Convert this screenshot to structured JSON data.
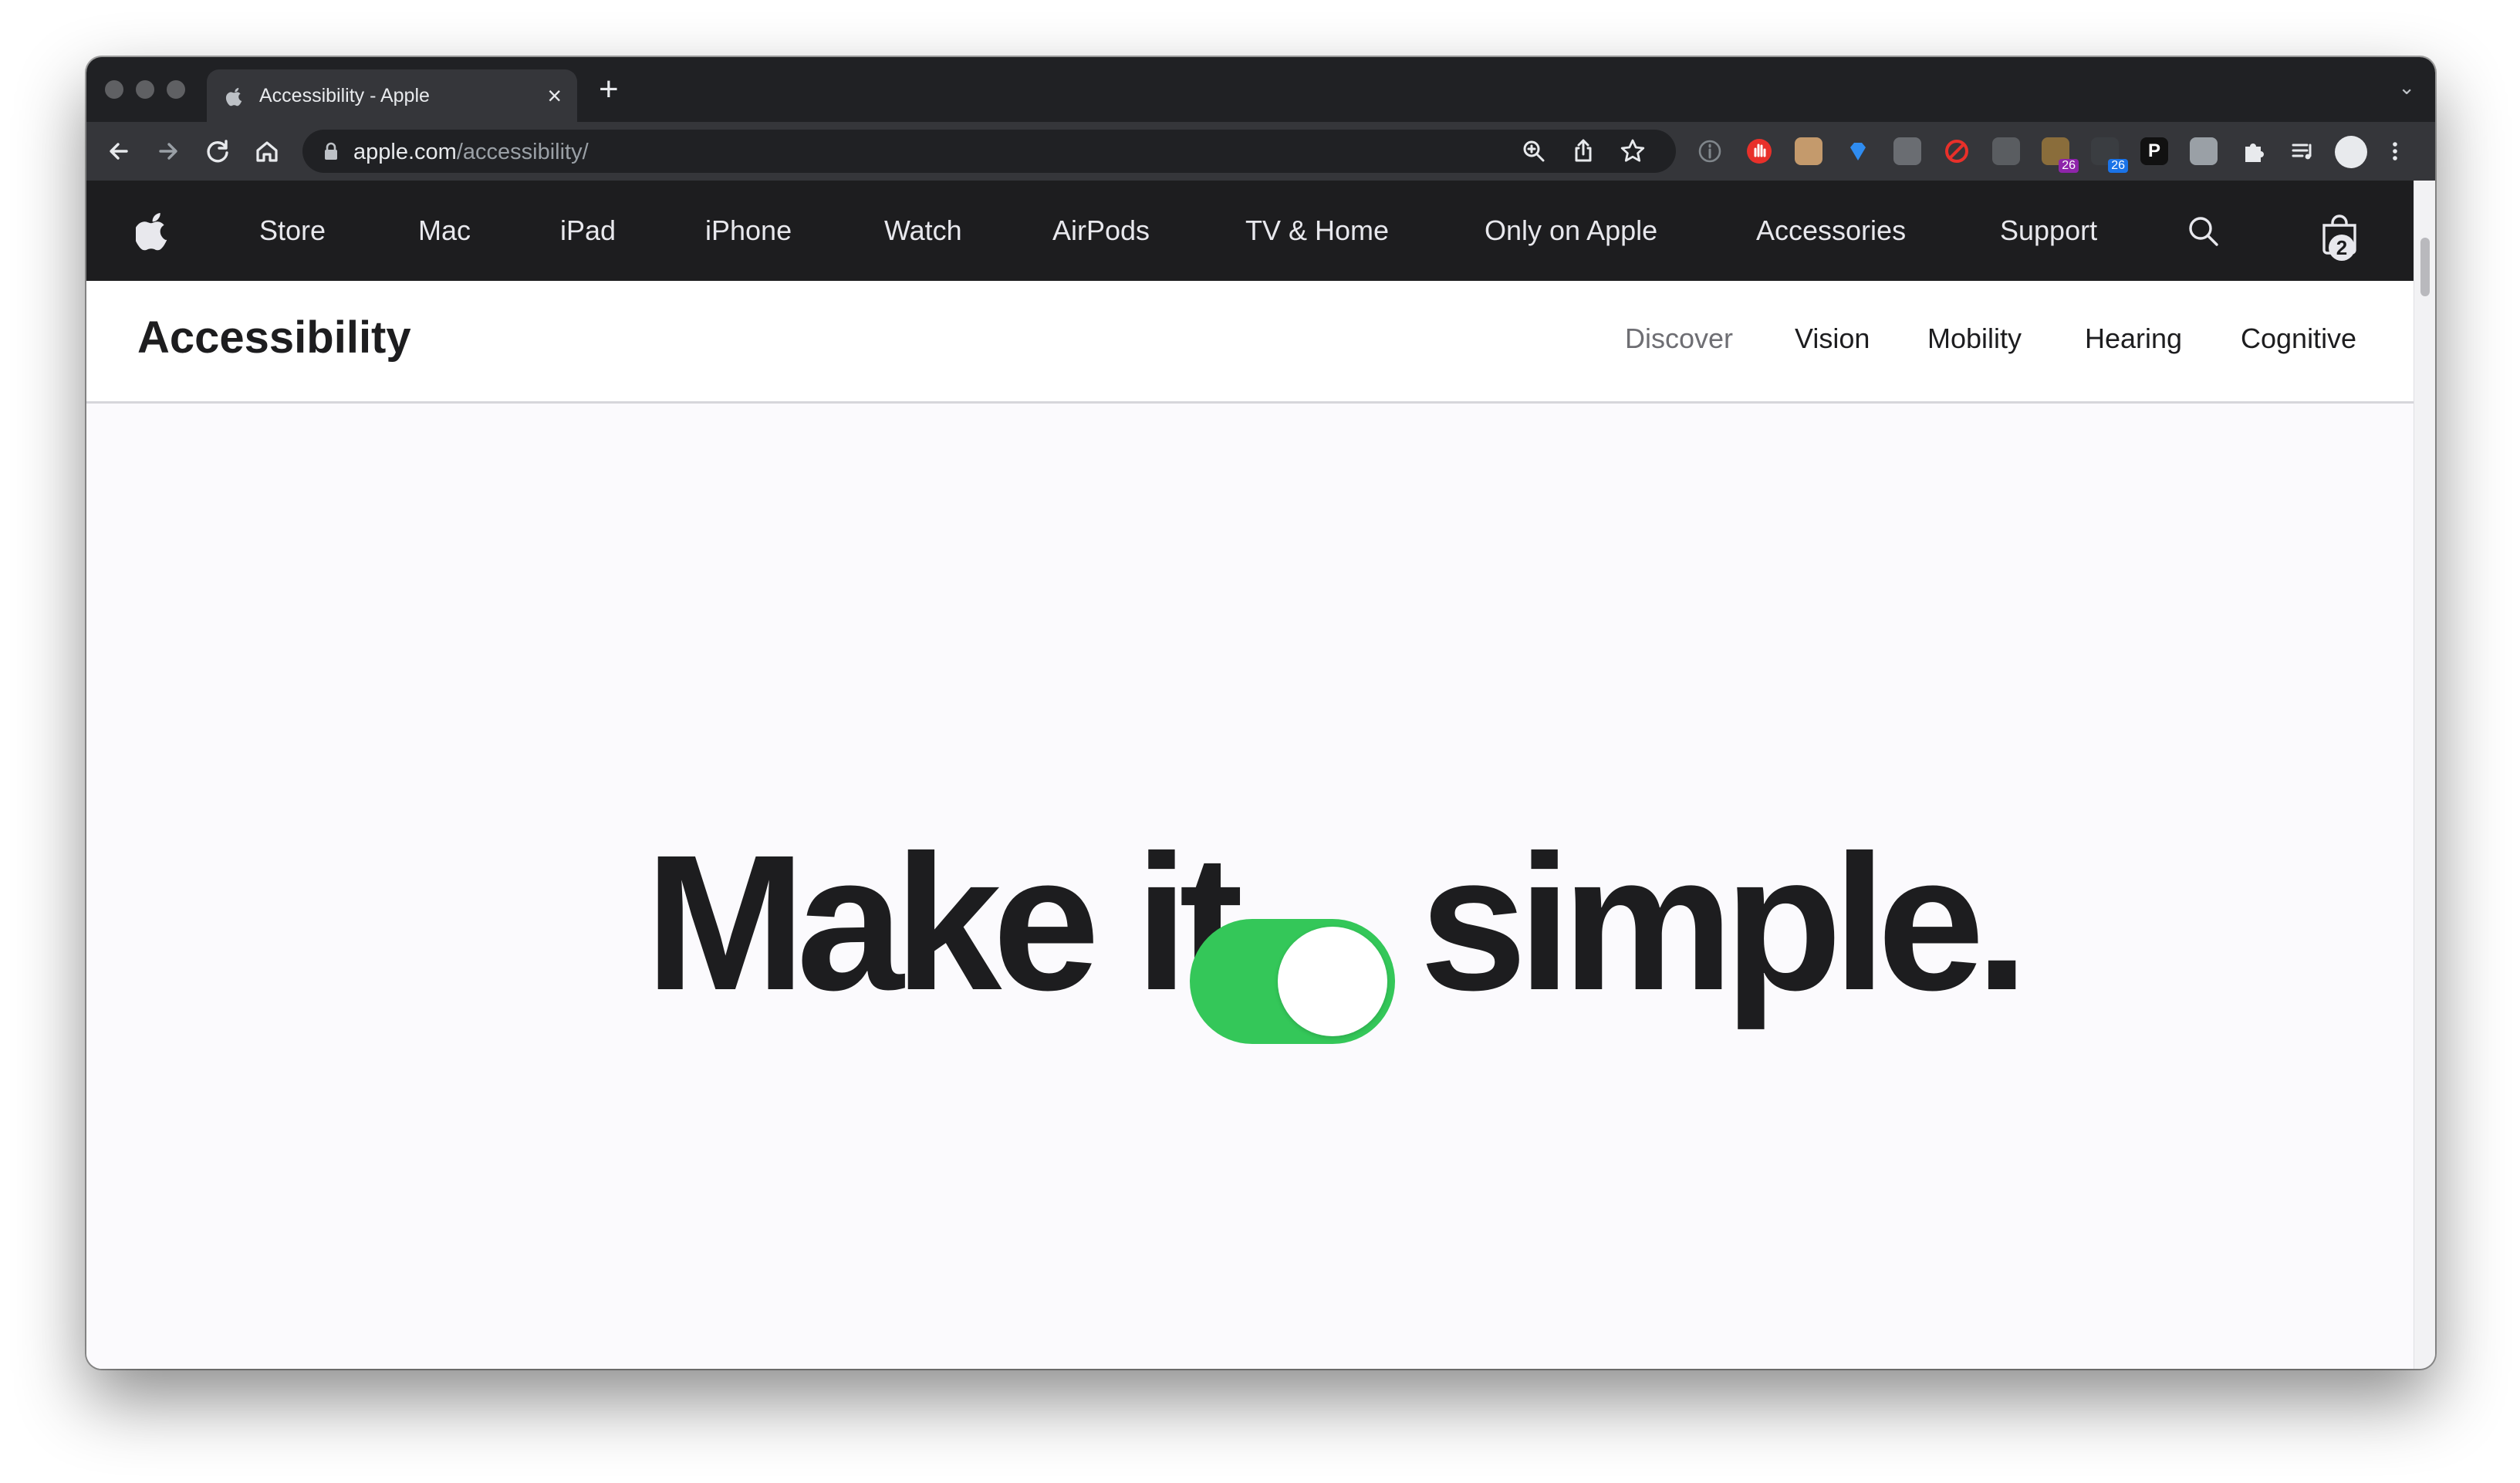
{
  "browser": {
    "tab_title": "Accessibility - Apple",
    "close_tab_glyph": "×",
    "new_tab_glyph": "+",
    "url_domain": "apple.com",
    "url_path": "/accessibility/",
    "extension_badges": [
      "26",
      "26"
    ],
    "extension_p_label": "P"
  },
  "globalnav": {
    "items": [
      "Store",
      "Mac",
      "iPad",
      "iPhone",
      "Watch",
      "AirPods",
      "TV & Home",
      "Only on Apple",
      "Accessories",
      "Support"
    ],
    "bag_count": "2"
  },
  "localnav": {
    "title": "Accessibility",
    "items": [
      "Discover",
      "Vision",
      "Mobility",
      "Hearing",
      "Cognitive"
    ],
    "current": "Discover"
  },
  "hero": {
    "before": "Make it",
    "after": "simple.",
    "toggle_state": "on",
    "toggle_color": "#34c759"
  },
  "colors": {
    "globalnav_bg": "#1d1d1f",
    "hero_bg": "#fbfafd",
    "chrome_tabstrip": "#202124",
    "chrome_toolbar": "#35363a"
  }
}
